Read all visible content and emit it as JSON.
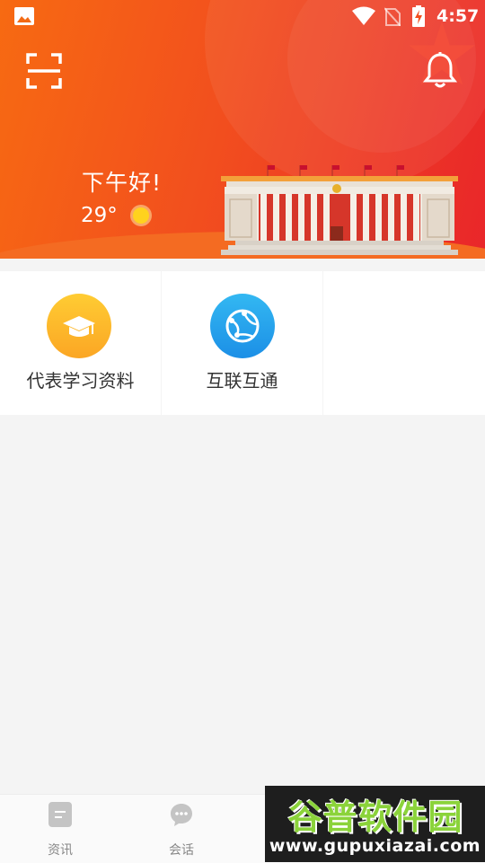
{
  "status_bar": {
    "time": "4:57",
    "icons": [
      "gallery-icon",
      "wifi-icon",
      "no-sim-icon",
      "battery-charging-icon"
    ]
  },
  "header": {
    "greeting": "下午好!",
    "temperature": "29°",
    "weather_icon": "sun-icon",
    "scan_icon": "scan-icon",
    "bell_icon": "bell-icon",
    "colors": {
      "gradient_start": "#f76a12",
      "gradient_end": "#e9262a"
    }
  },
  "grid": {
    "items": [
      {
        "label": "代表学习资料",
        "icon": "graduation-cap-icon",
        "color": "#fbb52a"
      },
      {
        "label": "互联互通",
        "icon": "globe-network-icon",
        "color": "#26a6ee"
      }
    ]
  },
  "bottom_nav": {
    "items": [
      {
        "label": "资讯",
        "icon": "news-doc-icon"
      },
      {
        "label": "会话",
        "icon": "chat-bubble-icon"
      }
    ]
  },
  "watermark": {
    "title": "谷普软件园",
    "url": "www.gupuxiazai.com"
  }
}
